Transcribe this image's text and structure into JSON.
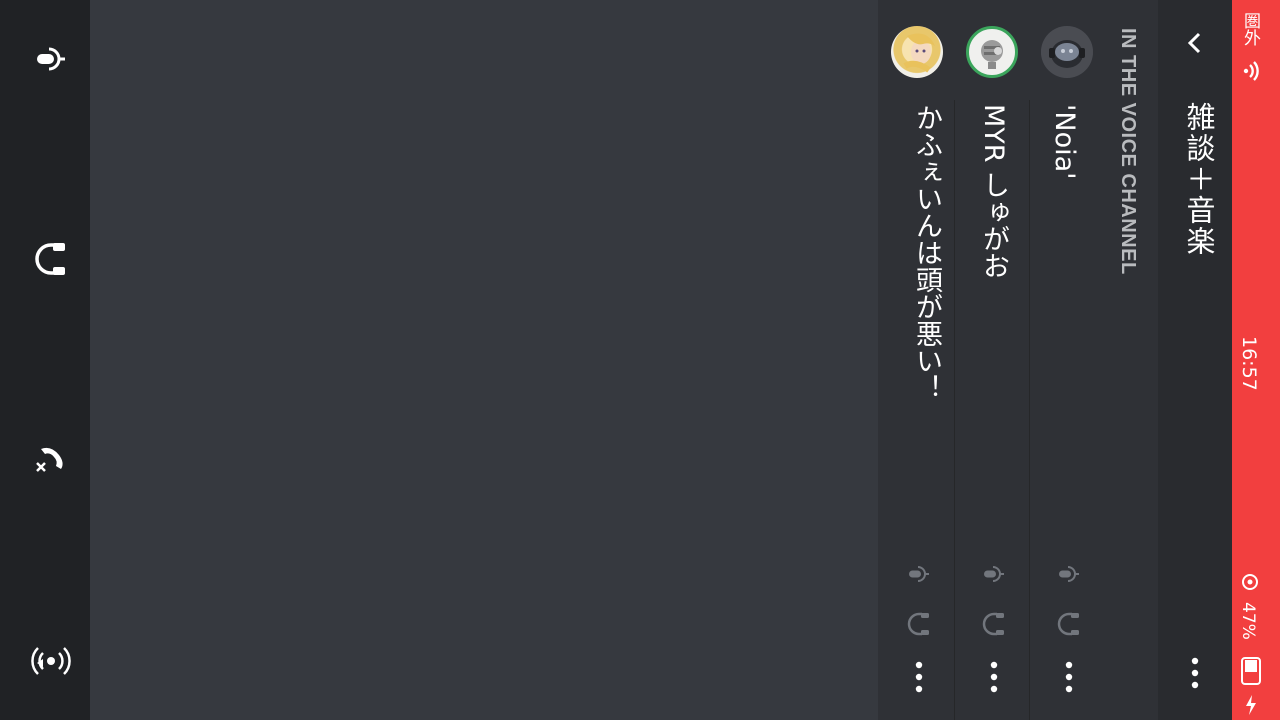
{
  "status_bar": {
    "carrier": "圏外",
    "time": "16:57",
    "battery": "47%"
  },
  "header": {
    "channel_name": "雑談＋音楽",
    "section_label": "IN THE VOICE CHANNEL"
  },
  "members": [
    {
      "name": "'Noia'",
      "speaking": false
    },
    {
      "name": "MYR しゅがお",
      "speaking": true
    },
    {
      "name": "かふぇいんは頭が悪い！",
      "speaking": false
    }
  ],
  "controls": [
    "microphone",
    "headphones",
    "disconnect",
    "camera-stream"
  ],
  "colors": {
    "status_bar": "#f23f3f",
    "speaking_ring": "#3ba55c",
    "panel": "#2f3136",
    "background": "#36393f"
  }
}
